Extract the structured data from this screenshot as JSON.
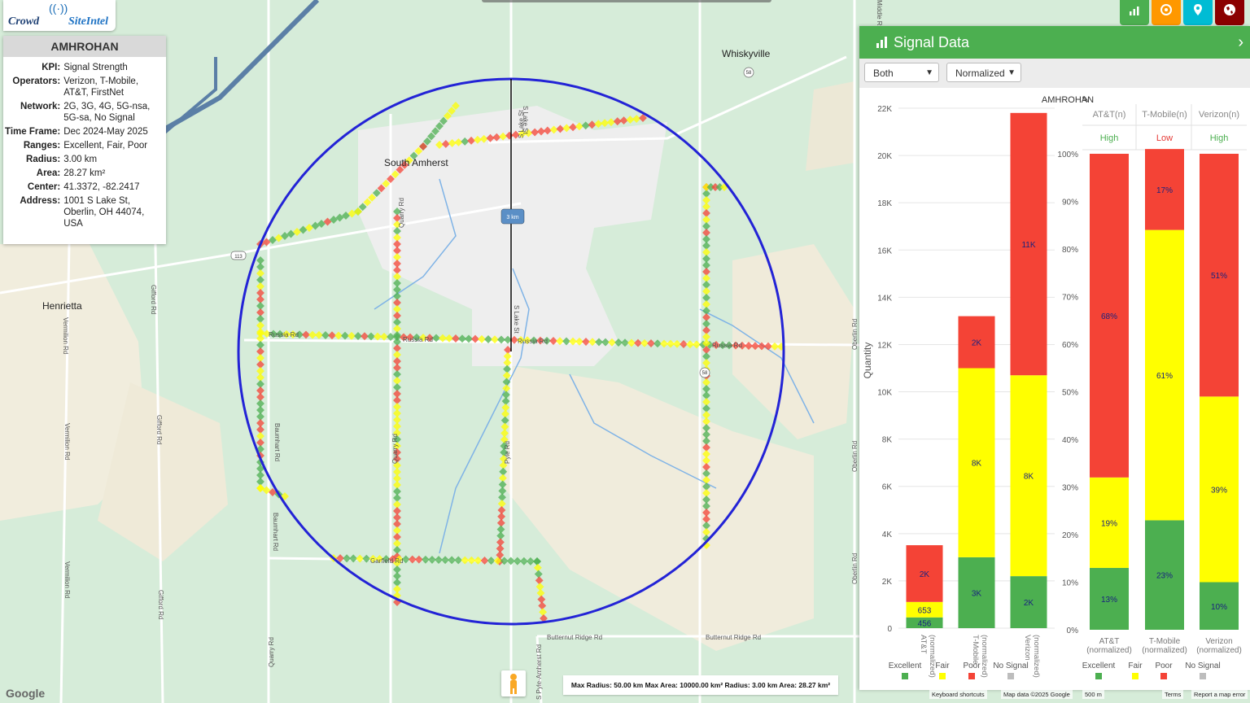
{
  "logo": {
    "part1": "Crowd",
    "part2": "SiteIntel",
    "antenna": "((·))"
  },
  "info": {
    "title": "AMHROHAN",
    "rows": [
      {
        "k": "KPI:",
        "v": "Signal Strength"
      },
      {
        "k": "Operators:",
        "v": "Verizon, T-Mobile, AT&T, FirstNet"
      },
      {
        "k": "Network:",
        "v": "2G, 3G, 4G, 5G-nsa, 5G-sa, No Signal"
      },
      {
        "k": "Time Frame:",
        "v": "Dec 2024-May 2025"
      },
      {
        "k": "Ranges:",
        "v": "Excellent, Fair, Poor"
      },
      {
        "k": "Radius:",
        "v": "3.00 km"
      },
      {
        "k": "Area:",
        "v": "28.27 km²"
      },
      {
        "k": "Center:",
        "v": "41.3372, -82.2417"
      },
      {
        "k": "Address:",
        "v": "1001 S Lake St, Oberlin, OH 44074, USA"
      }
    ]
  },
  "map": {
    "places": [
      {
        "name": "Whiskyville"
      },
      {
        "name": "South Amherst"
      },
      {
        "name": "Henrietta"
      }
    ],
    "roads": [
      "S Lake St",
      "Russia Rd",
      "Quarry Rd",
      "Pyle Rd",
      "Garfield Rd",
      "Baumhart Rd",
      "Gifford Rd",
      "Vermilion Rd",
      "Oberlin Rd",
      "Butternut Ridge Rd",
      "S Pyle-Amherst Rd",
      "Middle Ridge Rd"
    ],
    "shields": [
      "113",
      "58",
      "58"
    ],
    "radius_label": "3 km",
    "info_bar": "Max Radius: 50.00 km Max Area: 10000.00 km² Radius: 3.00 km Area: 28.27 km²",
    "google": "Google",
    "attrib_keyboard": "Keyboard shortcuts",
    "attrib_data": "Map data ©2025 Google",
    "attrib_scale": "500 m",
    "attrib_terms": "Terms",
    "attrib_report": "Report a map error"
  },
  "top_buttons": [
    {
      "icon": "bar-chart-icon",
      "color": "#4caf50"
    },
    {
      "icon": "target-icon",
      "color": "#ff9800"
    },
    {
      "icon": "map-pin-icon",
      "color": "#00bcd4"
    },
    {
      "icon": "globe-icon",
      "color": "#8b0000"
    }
  ],
  "panel": {
    "title": "Signal Data",
    "select1": "Both",
    "select2": "Normalized",
    "site_label": "AMHROHAN",
    "operator_headers": [
      {
        "name": "AT&T",
        "sup": "(n)",
        "rating": "High",
        "color": "#4caf50"
      },
      {
        "name": "T-Mobile",
        "sup": "(n)",
        "rating": "Low",
        "color": "#e53935"
      },
      {
        "name": "Verizon",
        "sup": "(n)",
        "rating": "High",
        "color": "#4caf50"
      }
    ],
    "legend": [
      "Excellent",
      "Fair",
      "Poor",
      "No Signal"
    ]
  },
  "colors": {
    "excellent": "#4caf50",
    "fair": "#ffff00",
    "poor": "#f44336",
    "nosignal": "#bdbdbd",
    "circle": "#2323d6"
  },
  "chart_data": [
    {
      "type": "bar",
      "stacked": true,
      "ylabel": "Quantity",
      "ylim": [
        0,
        22000
      ],
      "yticks": [
        "0",
        "2K",
        "4K",
        "6K",
        "8K",
        "10K",
        "12K",
        "14K",
        "16K",
        "18K",
        "20K",
        "22K"
      ],
      "categories": [
        "AT&T (normalized)",
        "T-Mobile (normalized)",
        "Verizon (normalized)"
      ],
      "series": [
        {
          "name": "Excellent",
          "values": [
            456,
            3000,
            2200
          ],
          "labels": [
            "456",
            "3K",
            "2K"
          ]
        },
        {
          "name": "Fair",
          "values": [
            653,
            8000,
            8500
          ],
          "labels": [
            "653",
            "8K",
            "8K"
          ]
        },
        {
          "name": "Poor",
          "values": [
            2400,
            2200,
            11100
          ],
          "labels": [
            "2K",
            "2K",
            "11K"
          ]
        },
        {
          "name": "No Signal",
          "values": [
            0,
            0,
            0
          ],
          "labels": [
            "",
            "",
            ""
          ]
        }
      ]
    },
    {
      "type": "bar",
      "stacked": true,
      "ylim": [
        0,
        100
      ],
      "yticks": [
        "0%",
        "10%",
        "20%",
        "30%",
        "40%",
        "50%",
        "60%",
        "70%",
        "80%",
        "90%",
        "100%"
      ],
      "categories": [
        "AT&T (normalized)",
        "T-Mobile (normalized)",
        "Verizon (normalized)"
      ],
      "series": [
        {
          "name": "Excellent",
          "values": [
            13,
            23,
            10
          ],
          "labels": [
            "13%",
            "23%",
            "10%"
          ]
        },
        {
          "name": "Fair",
          "values": [
            19,
            61,
            39
          ],
          "labels": [
            "19%",
            "61%",
            "39%"
          ]
        },
        {
          "name": "Poor",
          "values": [
            68,
            17,
            51
          ],
          "labels": [
            "68%",
            "17%",
            "51%"
          ]
        },
        {
          "name": "No Signal",
          "values": [
            0,
            0,
            0
          ],
          "labels": [
            "",
            "",
            ""
          ]
        }
      ]
    }
  ]
}
